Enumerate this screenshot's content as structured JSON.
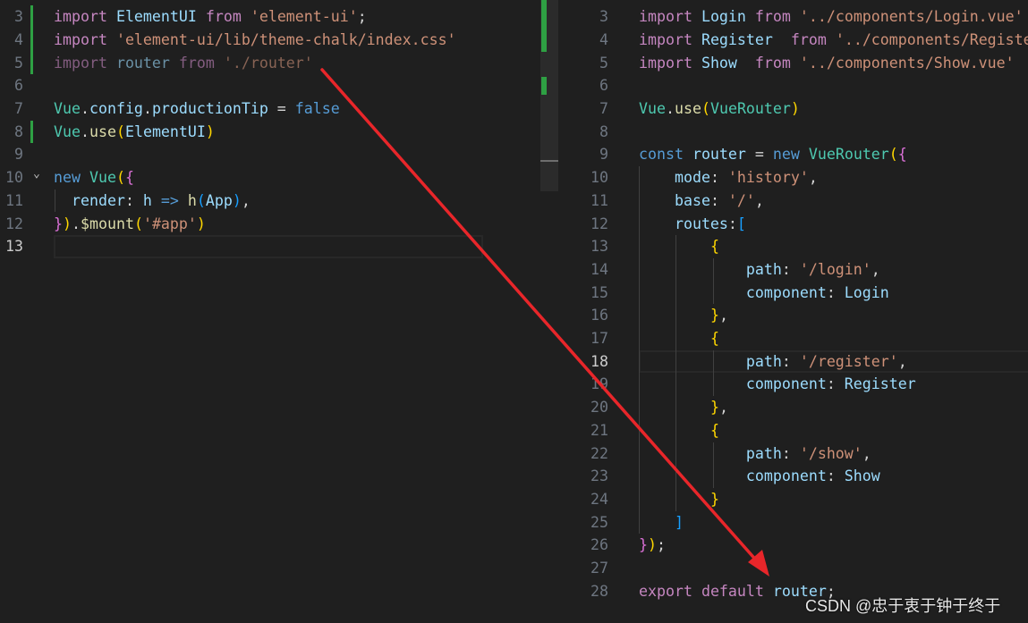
{
  "colors": {
    "background": "#1f1f1f",
    "arrow": "#e8262a",
    "git_added": "#2ea043"
  },
  "left_editor": {
    "current_line": 13,
    "lines": [
      {
        "n": 3,
        "added": true,
        "tokens": [
          [
            "import",
            "kw"
          ],
          [
            " ",
            "pl"
          ],
          [
            "ElementUI",
            "id"
          ],
          [
            " ",
            "pl"
          ],
          [
            "from",
            "kw"
          ],
          [
            " ",
            "pl"
          ],
          [
            "'element-ui'",
            "str"
          ],
          [
            ";",
            "pl"
          ]
        ]
      },
      {
        "n": 4,
        "added": true,
        "tokens": [
          [
            "import",
            "kw"
          ],
          [
            " ",
            "pl"
          ],
          [
            "'element-ui/lib/theme-chalk/index.css'",
            "str"
          ]
        ]
      },
      {
        "n": 5,
        "added": true,
        "dim": true,
        "tokens": [
          [
            "import",
            "kw"
          ],
          [
            " ",
            "pl"
          ],
          [
            "router",
            "id"
          ],
          [
            " ",
            "pl"
          ],
          [
            "from",
            "kw"
          ],
          [
            " ",
            "pl"
          ],
          [
            "'./router'",
            "str"
          ]
        ]
      },
      {
        "n": 6,
        "tokens": []
      },
      {
        "n": 7,
        "tokens": [
          [
            "Vue",
            "cls"
          ],
          [
            ".",
            "pl"
          ],
          [
            "config",
            "id"
          ],
          [
            ".",
            "pl"
          ],
          [
            "productionTip",
            "id"
          ],
          [
            " = ",
            "pl"
          ],
          [
            "false",
            "bl"
          ]
        ]
      },
      {
        "n": 8,
        "added": true,
        "tokens": [
          [
            "Vue",
            "cls"
          ],
          [
            ".",
            "pl"
          ],
          [
            "use",
            "fn"
          ],
          [
            "(",
            "b1"
          ],
          [
            "ElementUI",
            "id"
          ],
          [
            ")",
            "b1"
          ]
        ]
      },
      {
        "n": 9,
        "tokens": []
      },
      {
        "n": 10,
        "fold": true,
        "tokens": [
          [
            "new",
            "bl"
          ],
          [
            " ",
            "pl"
          ],
          [
            "Vue",
            "cls"
          ],
          [
            "(",
            "b1"
          ],
          [
            "{",
            "b2"
          ]
        ]
      },
      {
        "n": 11,
        "tokens": [
          [
            "  ",
            "pl"
          ],
          [
            "render",
            "id"
          ],
          [
            ": ",
            "pl"
          ],
          [
            "h",
            "id"
          ],
          [
            " ",
            "pl"
          ],
          [
            "=>",
            "bl"
          ],
          [
            " ",
            "pl"
          ],
          [
            "h",
            "fn"
          ],
          [
            "(",
            "b3"
          ],
          [
            "App",
            "id"
          ],
          [
            ")",
            "b3"
          ],
          [
            ",",
            "pl"
          ]
        ]
      },
      {
        "n": 12,
        "tokens": [
          [
            "}",
            "b2"
          ],
          [
            ")",
            "b1"
          ],
          [
            ".",
            "pl"
          ],
          [
            "$mount",
            "fn"
          ],
          [
            "(",
            "b1"
          ],
          [
            "'#app'",
            "str"
          ],
          [
            ")",
            "b1"
          ]
        ]
      },
      {
        "n": 13,
        "tokens": []
      }
    ]
  },
  "right_editor": {
    "current_line": 18,
    "lines": [
      {
        "n": 3,
        "tokens": [
          [
            "import",
            "kw"
          ],
          [
            " ",
            "pl"
          ],
          [
            "Login",
            "id"
          ],
          [
            " ",
            "pl"
          ],
          [
            "from",
            "kw"
          ],
          [
            " ",
            "pl"
          ],
          [
            "'../components/Login.vue'",
            "str"
          ]
        ]
      },
      {
        "n": 4,
        "tokens": [
          [
            "import",
            "kw"
          ],
          [
            " ",
            "pl"
          ],
          [
            "Register",
            "id"
          ],
          [
            "  ",
            "pl"
          ],
          [
            "from",
            "kw"
          ],
          [
            " ",
            "pl"
          ],
          [
            "'../components/Register.vue'",
            "str"
          ]
        ]
      },
      {
        "n": 5,
        "tokens": [
          [
            "import",
            "kw"
          ],
          [
            " ",
            "pl"
          ],
          [
            "Show",
            "id"
          ],
          [
            "  ",
            "pl"
          ],
          [
            "from",
            "kw"
          ],
          [
            " ",
            "pl"
          ],
          [
            "'../components/Show.vue'",
            "str"
          ]
        ]
      },
      {
        "n": 6,
        "tokens": []
      },
      {
        "n": 7,
        "tokens": [
          [
            "Vue",
            "cls"
          ],
          [
            ".",
            "pl"
          ],
          [
            "use",
            "fn"
          ],
          [
            "(",
            "b1"
          ],
          [
            "VueRouter",
            "cls"
          ],
          [
            ")",
            "b1"
          ]
        ]
      },
      {
        "n": 8,
        "tokens": []
      },
      {
        "n": 9,
        "tokens": [
          [
            "const",
            "bl"
          ],
          [
            " ",
            "pl"
          ],
          [
            "router",
            "id"
          ],
          [
            " = ",
            "pl"
          ],
          [
            "new",
            "bl"
          ],
          [
            " ",
            "pl"
          ],
          [
            "VueRouter",
            "cls"
          ],
          [
            "(",
            "b1"
          ],
          [
            "{",
            "b2"
          ]
        ]
      },
      {
        "n": 10,
        "tokens": [
          [
            "    ",
            "pl"
          ],
          [
            "mode",
            "id"
          ],
          [
            ": ",
            "pl"
          ],
          [
            "'history'",
            "str"
          ],
          [
            ",",
            "pl"
          ]
        ]
      },
      {
        "n": 11,
        "tokens": [
          [
            "    ",
            "pl"
          ],
          [
            "base",
            "id"
          ],
          [
            ": ",
            "pl"
          ],
          [
            "'/'",
            "str"
          ],
          [
            ",",
            "pl"
          ]
        ]
      },
      {
        "n": 12,
        "tokens": [
          [
            "    ",
            "pl"
          ],
          [
            "routes",
            "id"
          ],
          [
            ":",
            "pl"
          ],
          [
            "[",
            "b3"
          ]
        ]
      },
      {
        "n": 13,
        "tokens": [
          [
            "        ",
            "pl"
          ],
          [
            "{",
            "b1"
          ]
        ]
      },
      {
        "n": 14,
        "tokens": [
          [
            "            ",
            "pl"
          ],
          [
            "path",
            "id"
          ],
          [
            ": ",
            "pl"
          ],
          [
            "'/login'",
            "str"
          ],
          [
            ",",
            "pl"
          ]
        ]
      },
      {
        "n": 15,
        "tokens": [
          [
            "            ",
            "pl"
          ],
          [
            "component",
            "id"
          ],
          [
            ": ",
            "pl"
          ],
          [
            "Login",
            "id"
          ]
        ]
      },
      {
        "n": 16,
        "tokens": [
          [
            "        ",
            "pl"
          ],
          [
            "}",
            "b1"
          ],
          [
            ",",
            "pl"
          ]
        ]
      },
      {
        "n": 17,
        "tokens": [
          [
            "        ",
            "pl"
          ],
          [
            "{",
            "b1"
          ]
        ]
      },
      {
        "n": 18,
        "tokens": [
          [
            "            ",
            "pl"
          ],
          [
            "path",
            "id"
          ],
          [
            ": ",
            "pl"
          ],
          [
            "'/register'",
            "str"
          ],
          [
            ",",
            "pl"
          ]
        ]
      },
      {
        "n": 19,
        "tokens": [
          [
            "            ",
            "pl"
          ],
          [
            "component",
            "id"
          ],
          [
            ": ",
            "pl"
          ],
          [
            "Register",
            "id"
          ]
        ]
      },
      {
        "n": 20,
        "tokens": [
          [
            "        ",
            "pl"
          ],
          [
            "}",
            "b1"
          ],
          [
            ",",
            "pl"
          ]
        ]
      },
      {
        "n": 21,
        "tokens": [
          [
            "        ",
            "pl"
          ],
          [
            "{",
            "b1"
          ]
        ]
      },
      {
        "n": 22,
        "tokens": [
          [
            "            ",
            "pl"
          ],
          [
            "path",
            "id"
          ],
          [
            ": ",
            "pl"
          ],
          [
            "'/show'",
            "str"
          ],
          [
            ",",
            "pl"
          ]
        ]
      },
      {
        "n": 23,
        "tokens": [
          [
            "            ",
            "pl"
          ],
          [
            "component",
            "id"
          ],
          [
            ": ",
            "pl"
          ],
          [
            "Show",
            "id"
          ]
        ]
      },
      {
        "n": 24,
        "tokens": [
          [
            "        ",
            "pl"
          ],
          [
            "}",
            "b1"
          ]
        ]
      },
      {
        "n": 25,
        "tokens": [
          [
            "    ",
            "pl"
          ],
          [
            "]",
            "b3"
          ]
        ]
      },
      {
        "n": 26,
        "tokens": [
          [
            "}",
            "b2"
          ],
          [
            ")",
            "b1"
          ],
          [
            ";",
            "pl"
          ]
        ]
      },
      {
        "n": 27,
        "tokens": []
      },
      {
        "n": 28,
        "tokens": [
          [
            "export",
            "kw"
          ],
          [
            " ",
            "pl"
          ],
          [
            "default",
            "kw"
          ],
          [
            " ",
            "pl"
          ],
          [
            "router",
            "id"
          ],
          [
            ";",
            "pl"
          ]
        ]
      }
    ]
  },
  "annotation": {
    "type": "arrow",
    "from": "left line 5 './router'",
    "to": "right line 28 export default router"
  },
  "watermark": "CSDN @忠于衷于钟于终于"
}
